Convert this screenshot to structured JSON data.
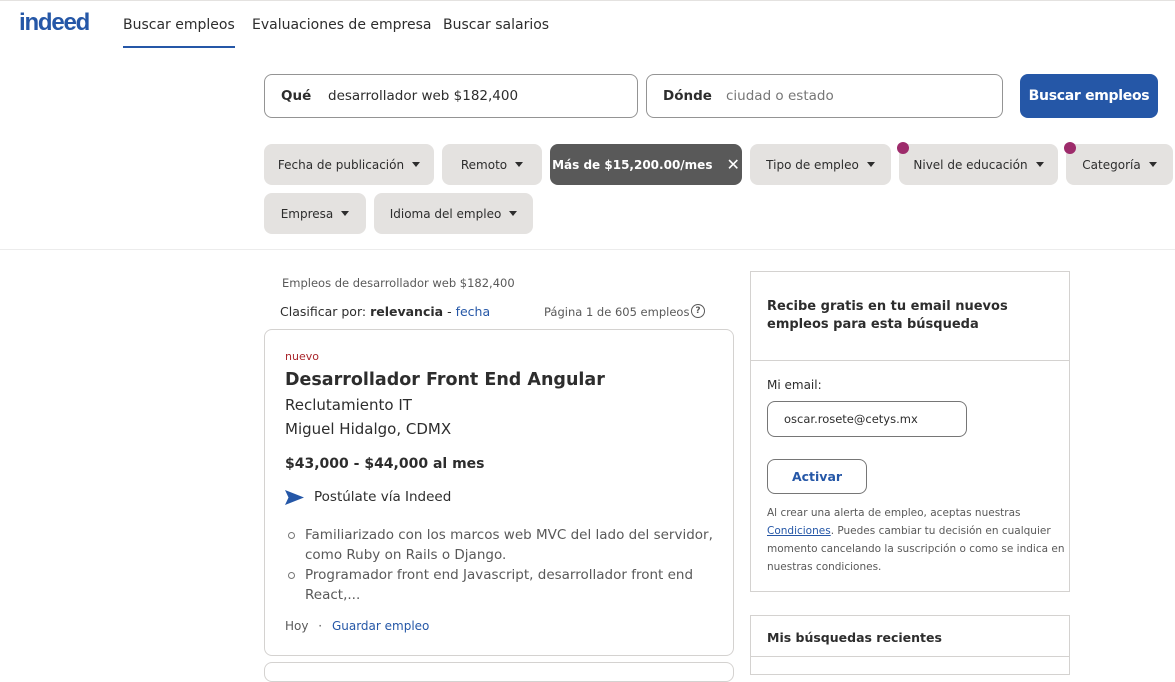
{
  "header": {
    "logo": "indeed",
    "nav": [
      "Buscar empleos",
      "Evaluaciones de empresa",
      "Buscar salarios"
    ]
  },
  "search": {
    "what_label": "Qué",
    "what_value": "desarrollador web $182,400",
    "where_label": "Dónde",
    "where_placeholder": "ciudad o estado",
    "button": "Buscar empleos"
  },
  "filters": {
    "date": "Fecha de publicación",
    "remote": "Remoto",
    "salary": "Más de $15,200.00/mes",
    "job_type": "Tipo de empleo",
    "education": "Nivel de educación",
    "category": "Categoría",
    "company": "Empresa",
    "language": "Idioma del empleo"
  },
  "results": {
    "title": "Empleos de desarrollador web $182,400",
    "sort_label": "Clasificar por:",
    "sort_relevance": "relevancia",
    "sort_sep": " - ",
    "sort_date": "fecha",
    "page_info": "Página 1 de 605 empleos",
    "help": "?"
  },
  "job": {
    "badge": "nuevo",
    "title": "Desarrollador Front End Angular",
    "company": "Reclutamiento IT",
    "location": "Miguel Hidalgo, CDMX",
    "salary": "$43,000 - $44,000 al mes",
    "apply": "Postúlate vía Indeed",
    "bullets": [
      "Familiarizado con los marcos web MVC del lado del servidor, como Ruby on Rails o Django.",
      "Programador front end Javascript, desarrollador front end React,..."
    ],
    "posted": "Hoy",
    "sep": "·",
    "save": "Guardar empleo"
  },
  "alert": {
    "heading": "Recibe gratis en tu email nuevos empleos para esta búsqueda",
    "email_label": "Mi email:",
    "email_value": "oscar.rosete@cetys.mx",
    "button": "Activar",
    "legal_pre": "Al crear una alerta de empleo, aceptas nuestras ",
    "legal_link": "Condiciones",
    "legal_post": ". Puedes cambiar tu decisión en cualquier momento cancelando la suscripción o como se indica en nuestras condiciones."
  },
  "recent": {
    "title": "Mis búsquedas recientes"
  },
  "colors": {
    "brand": "#2557a7",
    "dot": "#9d2b6b",
    "new": "#a9252b"
  }
}
